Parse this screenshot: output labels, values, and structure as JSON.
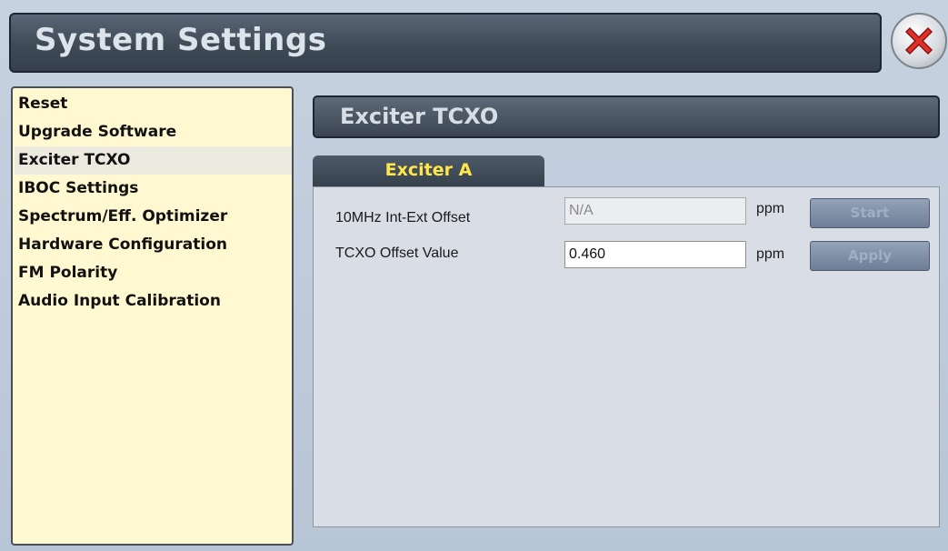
{
  "window": {
    "title": "System Settings"
  },
  "icons": {
    "close": "close-icon",
    "close_color": "#e0302a"
  },
  "sidebar": {
    "items": [
      {
        "label": "Reset",
        "active": false
      },
      {
        "label": "Upgrade Software",
        "active": false
      },
      {
        "label": "Exciter TCXO",
        "active": true
      },
      {
        "label": "IBOC Settings",
        "active": false
      },
      {
        "label": "Spectrum/Eff. Optimizer",
        "active": false
      },
      {
        "label": "Hardware Configuration",
        "active": false
      },
      {
        "label": "FM Polarity",
        "active": false
      },
      {
        "label": "Audio Input Calibration",
        "active": false
      }
    ]
  },
  "main": {
    "section_title": "Exciter TCXO",
    "tabs": [
      {
        "label": "Exciter A",
        "active": true
      }
    ],
    "fields": [
      {
        "label": "10MHz Int-Ext Offset",
        "value": "N/A",
        "unit": "ppm",
        "button": "Start",
        "disabled": true
      },
      {
        "label": "TCXO Offset Value",
        "value": "0.460",
        "unit": "ppm",
        "button": "Apply",
        "disabled": false
      }
    ]
  }
}
